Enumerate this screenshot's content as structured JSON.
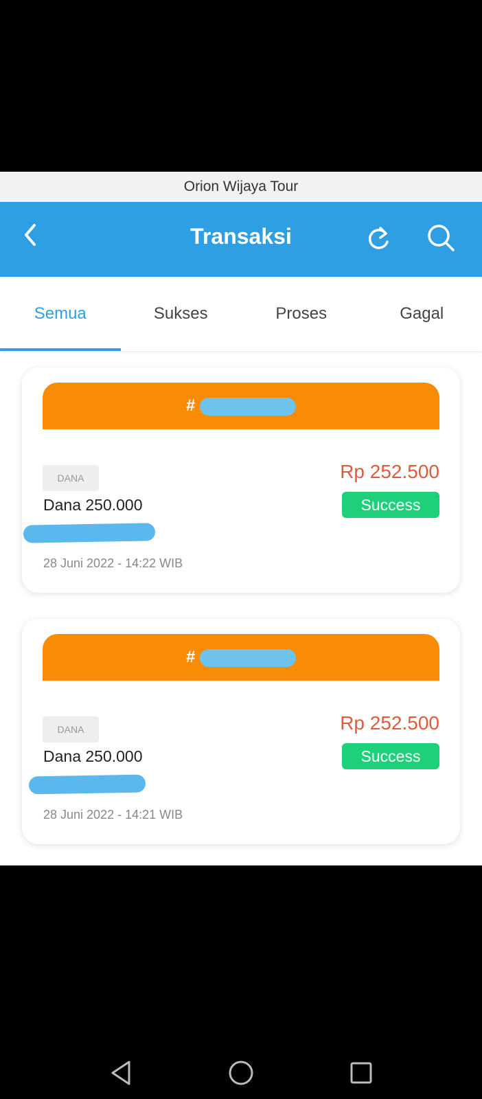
{
  "app": {
    "name": "Orion Wijaya Tour"
  },
  "header": {
    "title": "Transaksi",
    "back_icon": "chevron-left-icon",
    "refresh_icon": "refresh-icon",
    "search_icon": "search-icon"
  },
  "tabs": [
    {
      "label": "Semua",
      "active": true
    },
    {
      "label": "Sukses",
      "active": false
    },
    {
      "label": "Proses",
      "active": false
    },
    {
      "label": "Gagal",
      "active": false
    }
  ],
  "transactions": [
    {
      "id_prefix": "#",
      "method": "DANA",
      "product": "Dana 250.000",
      "price": "Rp 252.500",
      "status": "Success",
      "date": "28 Juni 2022 - 14:22 WIB"
    },
    {
      "id_prefix": "#",
      "method": "DANA",
      "product": "Dana 250.000",
      "price": "Rp 252.500",
      "status": "Success",
      "date": "28 Juni 2022 - 14:21 WIB"
    }
  ],
  "colors": {
    "primary": "#2f9fe4",
    "banner": "#f98c07",
    "price": "#e05a3b",
    "success": "#1ed07a"
  }
}
